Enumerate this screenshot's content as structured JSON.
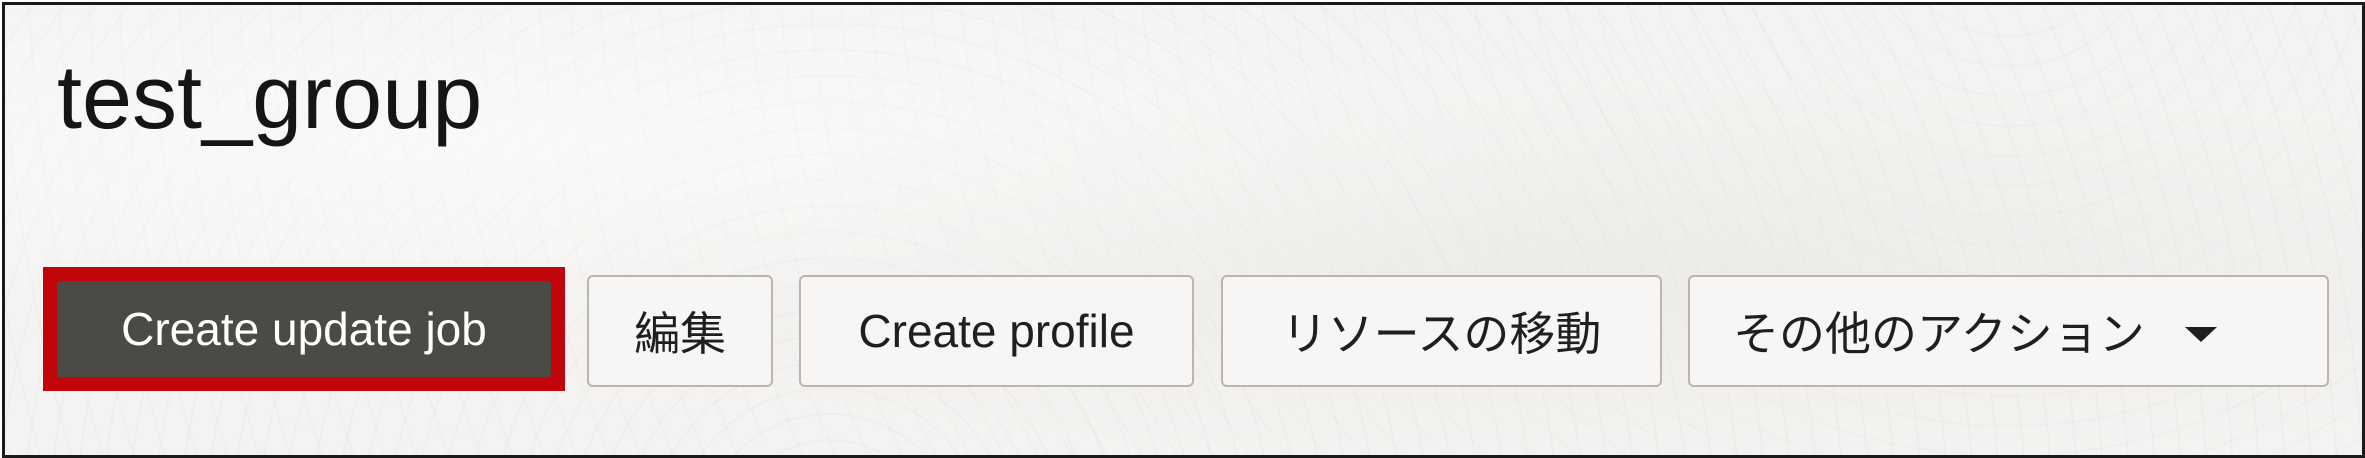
{
  "header": {
    "title": "test_group"
  },
  "toolbar": {
    "create_update_job": "Create update job",
    "edit": "編集",
    "create_profile": "Create profile",
    "move_resource": "リソースの移動",
    "more_actions": "その他のアクション"
  },
  "colors": {
    "primary_button": "#4c4a45",
    "highlight_border": "#c1050b",
    "background": "#f4f3f1"
  },
  "icons": {
    "more_actions_caret": "chevron-down-icon"
  }
}
